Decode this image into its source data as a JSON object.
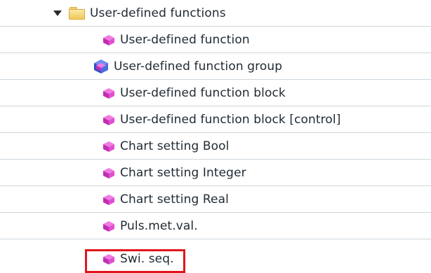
{
  "tree": {
    "folder": {
      "label": "User-defined functions",
      "icon": "folder-icon",
      "expanded": true
    },
    "items": [
      {
        "label": "User-defined function",
        "icon": "function-cube-icon"
      },
      {
        "label": "User-defined function group",
        "icon": "function-group-icon"
      },
      {
        "label": "User-defined function block",
        "icon": "function-cube-icon"
      },
      {
        "label": "User-defined function block [control]",
        "icon": "function-cube-icon"
      },
      {
        "label": "Chart setting Bool",
        "icon": "function-cube-icon"
      },
      {
        "label": "Chart setting Integer",
        "icon": "function-cube-icon"
      },
      {
        "label": "Chart setting Real",
        "icon": "function-cube-icon"
      },
      {
        "label": "Puls.met.val.",
        "icon": "function-cube-icon"
      },
      {
        "label": "Swi. seq.",
        "icon": "function-cube-icon",
        "highlighted": true
      }
    ]
  },
  "colors": {
    "cube_magenta": "#d63fc8",
    "cube_blue": "#3a63d6",
    "highlight_border": "#e0161c",
    "row_divider": "#cdd6de"
  }
}
